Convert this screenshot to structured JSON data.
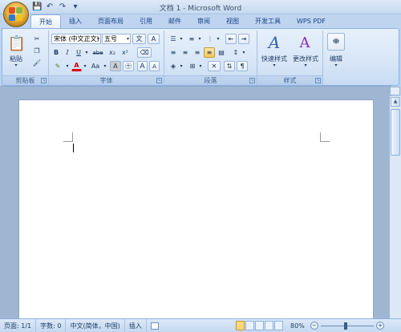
{
  "window": {
    "title": "文档 1 - Microsoft Word"
  },
  "quick_access": {
    "save_icon": "save-icon",
    "undo_icon": "undo-icon",
    "redo_icon": "redo-icon"
  },
  "tabs": [
    {
      "label": "开始",
      "active": true
    },
    {
      "label": "插入"
    },
    {
      "label": "页面布局"
    },
    {
      "label": "引用"
    },
    {
      "label": "邮件"
    },
    {
      "label": "审阅"
    },
    {
      "label": "视图"
    },
    {
      "label": "开发工具"
    },
    {
      "label": "WPS PDF"
    }
  ],
  "ribbon": {
    "clipboard": {
      "label": "剪贴板",
      "paste_label": "粘贴"
    },
    "font": {
      "label": "字体",
      "font_name": "宋体 (中文正文)",
      "font_size": "五号",
      "bold": "B",
      "italic": "I",
      "underline": "U",
      "strike": "abe",
      "subscript": "x₂",
      "superscript": "x²",
      "change_case": "Aa",
      "char_border": "A",
      "enclose": "㊉",
      "font_color": "A",
      "grow": "A",
      "shrink": "A",
      "wen": "文",
      "wen2": "A"
    },
    "paragraph": {
      "label": "段落"
    },
    "styles": {
      "label": "样式",
      "quick_styles": "快速样式",
      "change_styles": "更改样式"
    },
    "editing": {
      "label": "编辑"
    }
  },
  "status": {
    "page": "页面: 1/1",
    "words": "字数: 0",
    "language": "中文(简体，中国)",
    "mode": "插入",
    "zoom": "80%"
  },
  "colors": {
    "accent": "#15428b",
    "ribbon_bg": "#d6e5f7",
    "highlight": "#f9c85a"
  }
}
